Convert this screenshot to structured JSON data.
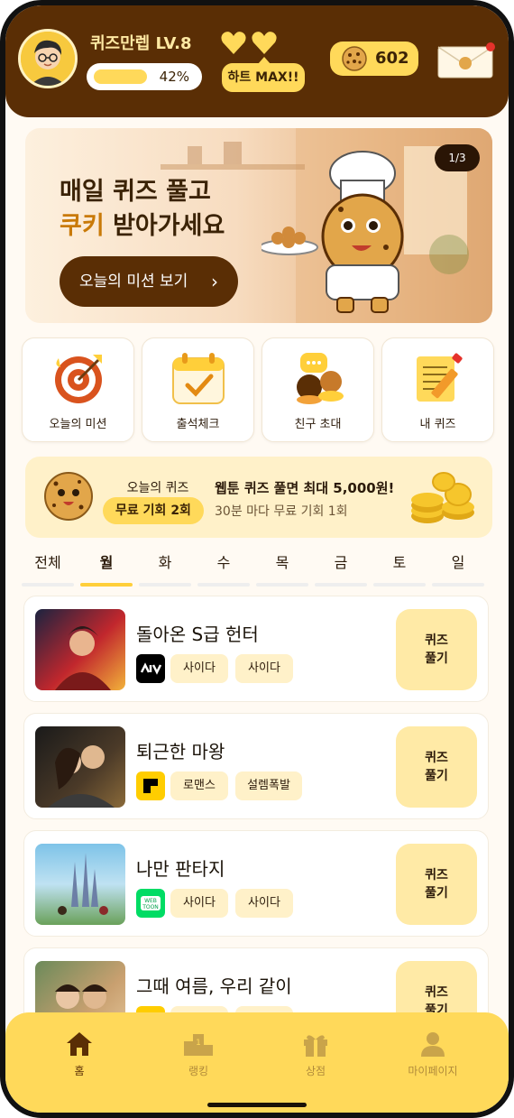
{
  "header": {
    "nickname": "퀴즈만렙 LV.8",
    "xp_percent_label": "42%",
    "xp_progress": 0.42,
    "hearts_count": 2,
    "heart_badge": "하트 MAX!!",
    "cookie_count": "602",
    "mail_has_notification": true
  },
  "banner": {
    "title_line1": "매일 퀴즈 풀고",
    "title_line2_highlight": "쿠키",
    "title_line2_rest": " 받아가세요",
    "button_label": "오늘의 미션 보기",
    "pager": "1/3"
  },
  "menu": [
    {
      "label": "오늘의 미션",
      "icon": "target-icon"
    },
    {
      "label": "출석체크",
      "icon": "calendar-check-icon"
    },
    {
      "label": "친구 초대",
      "icon": "chat-bubble-icon"
    },
    {
      "label": "내 퀴즈",
      "icon": "notepad-pencil-icon"
    }
  ],
  "quiz_info": {
    "label": "오늘의 퀴즈",
    "free_chance": "무료 기회 2회",
    "headline": "웹툰 퀴즈 풀면 최대 5,000원!",
    "subline": "30분 마다 무료 기회 1회"
  },
  "tabs": [
    "전체",
    "월",
    "화",
    "수",
    "목",
    "금",
    "토",
    "일"
  ],
  "active_tab": 1,
  "list": [
    {
      "title": "돌아온 S급 헌터",
      "platform": "kakao-page-icon",
      "tags": [
        "사이다",
        "사이다"
      ],
      "button": "퀴즈\n풀기"
    },
    {
      "title": "퇴근한 마왕",
      "platform": "kakao-webtoon-icon",
      "tags": [
        "로맨스",
        "설렘폭발"
      ],
      "button": "퀴즈\n풀기"
    },
    {
      "title": "나만 판타지",
      "platform": "naver-webtoon-icon",
      "tags": [
        "사이다",
        "사이다"
      ],
      "button": "퀴즈\n풀기"
    },
    {
      "title": "그때 여름, 우리 같이",
      "platform": "kakao-webtoon-icon",
      "tags": [
        "",
        ""
      ],
      "button": "퀴즈\n풀기"
    }
  ],
  "bottom_nav": [
    {
      "label": "홈",
      "icon": "home-icon",
      "active": true
    },
    {
      "label": "랭킹",
      "icon": "podium-icon",
      "active": false
    },
    {
      "label": "상점",
      "icon": "gift-icon",
      "active": false
    },
    {
      "label": "마이페이지",
      "icon": "person-icon",
      "active": false
    }
  ],
  "colors": {
    "header_bg": "#5a2e05",
    "accent_yellow": "#ffd95a",
    "light_yellow": "#fff1c9",
    "highlight": "#c97a08"
  }
}
